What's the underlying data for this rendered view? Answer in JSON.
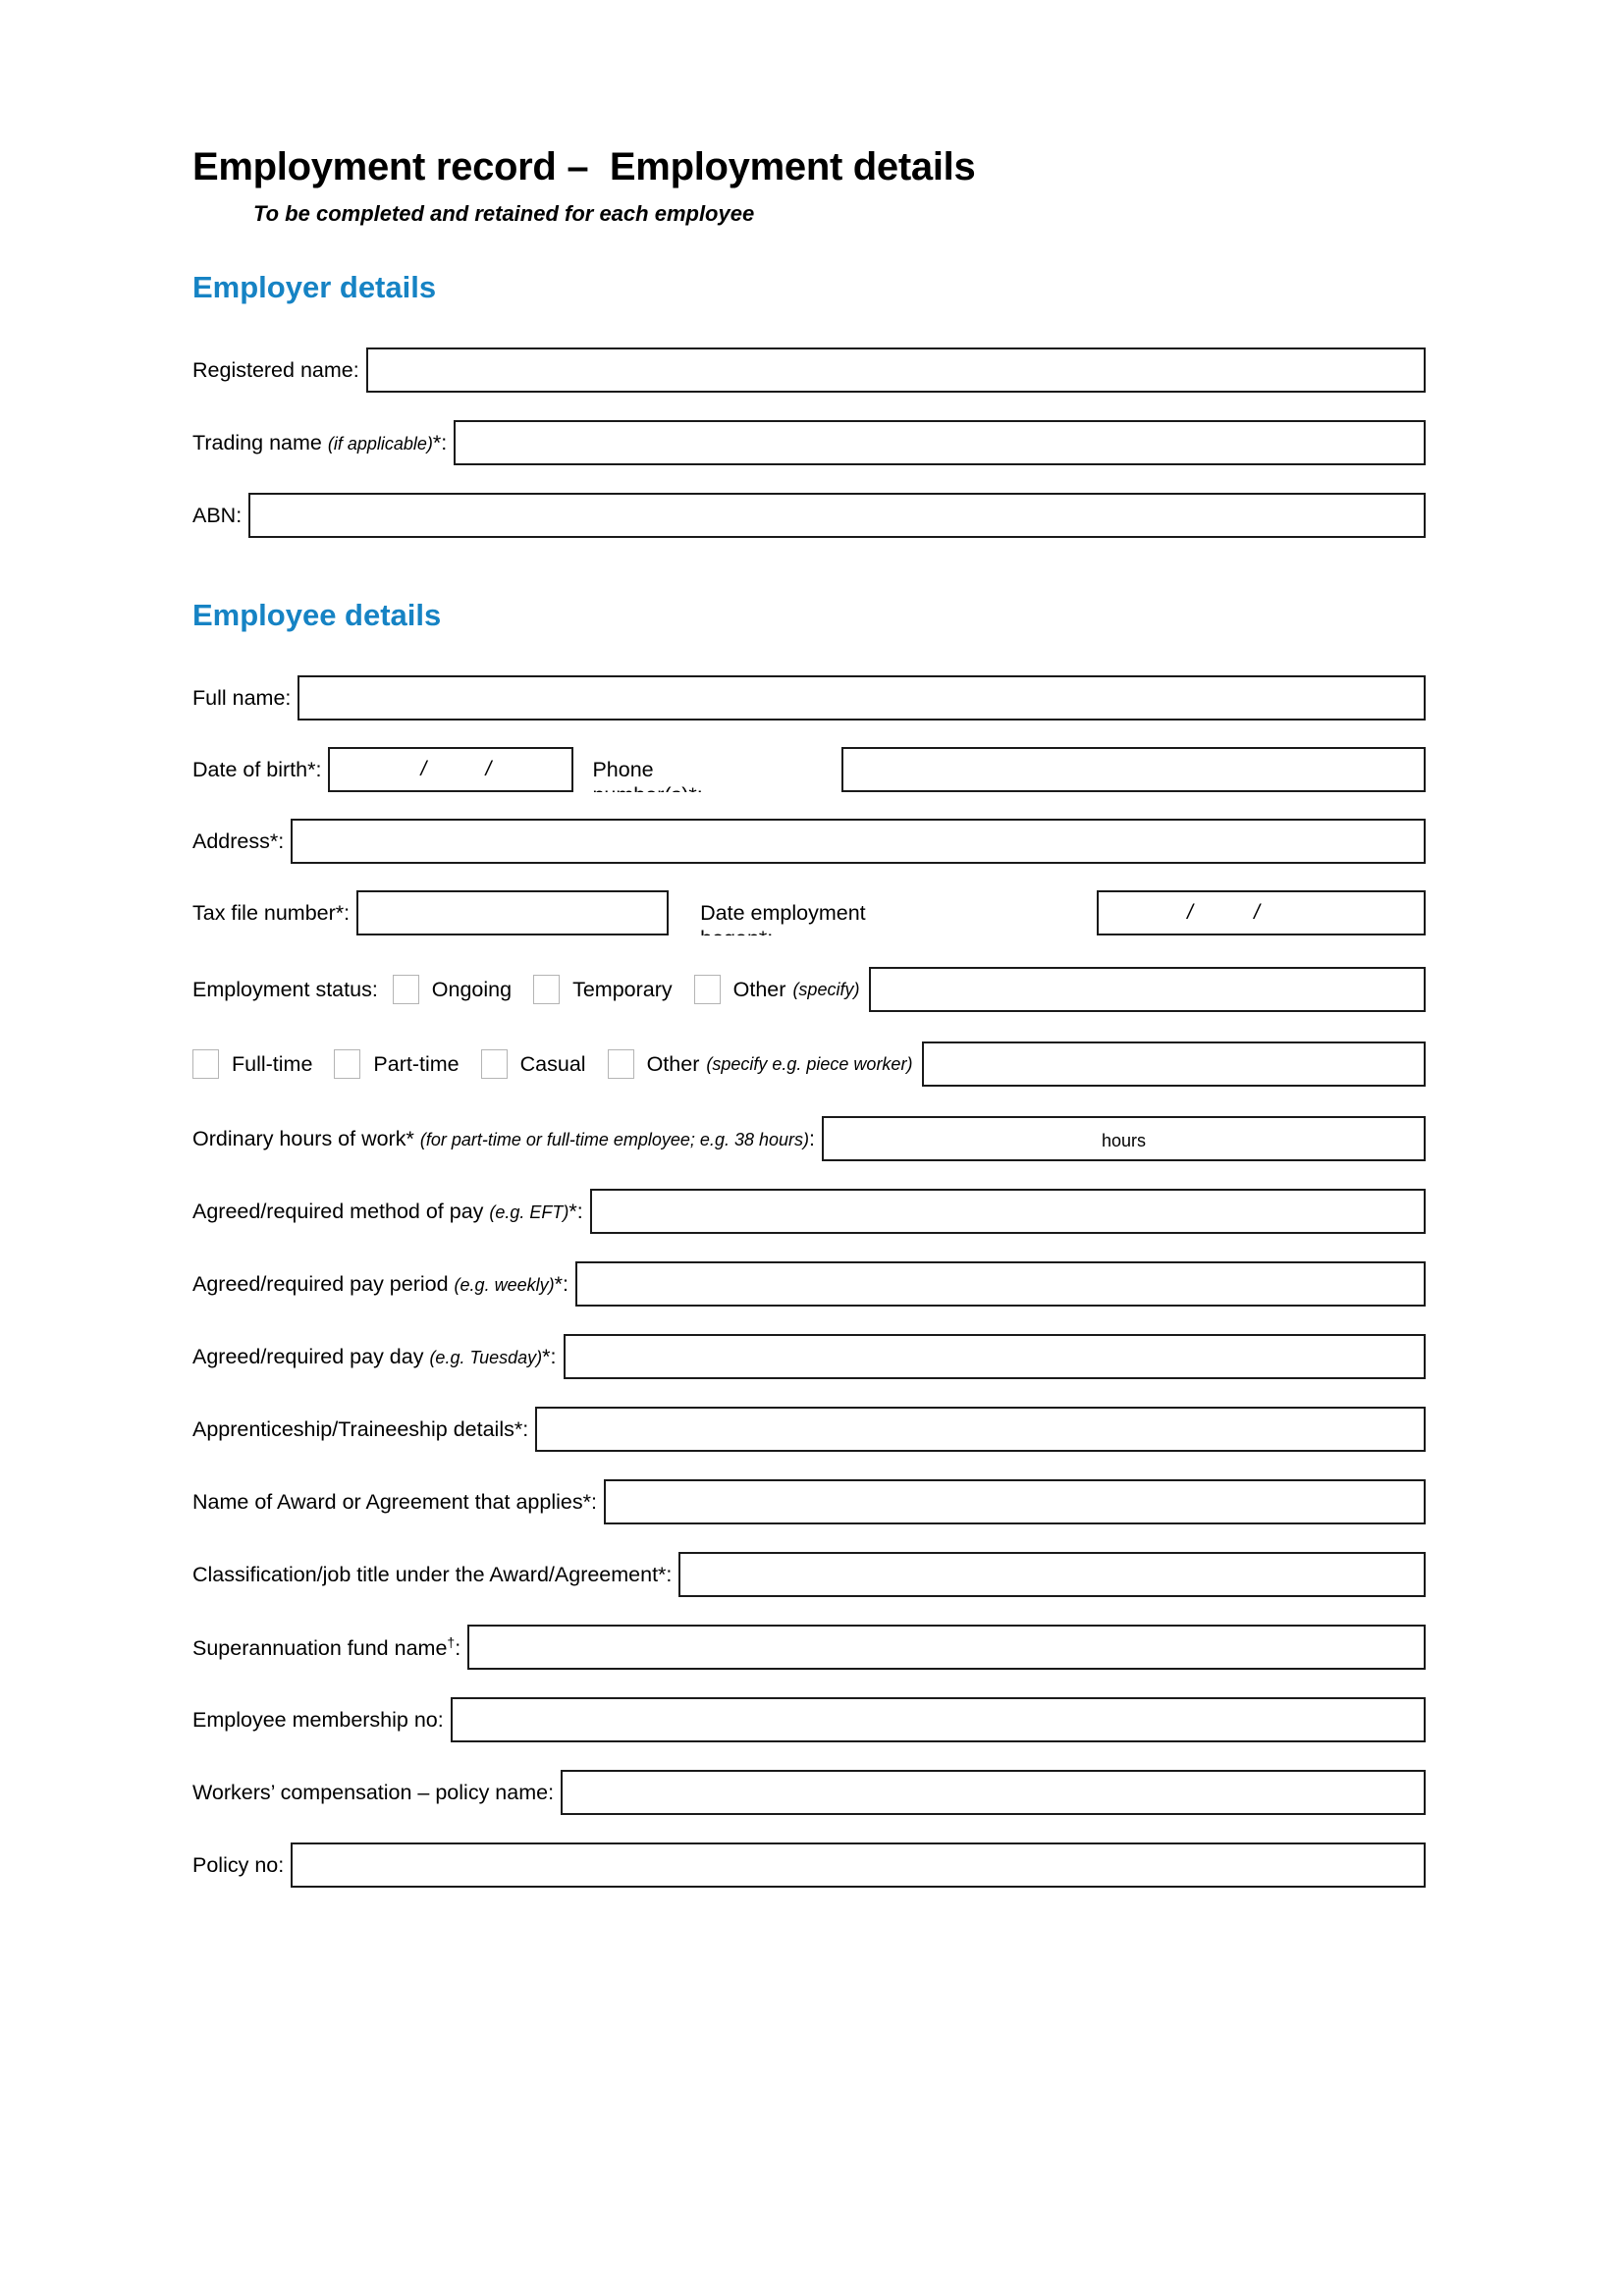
{
  "document": {
    "title": "Employment record –  Employment details",
    "subtitle": "To be completed and retained for each employee",
    "accent_color": "#1683c4",
    "box_border_color": "#1a1a1a",
    "checkbox_border_color": "#b4b4b4"
  },
  "employer_section": {
    "heading": "Employer details",
    "fields": [
      {
        "label": "Registered name:",
        "value": ""
      },
      {
        "label_main": "Trading name ",
        "label_italic": "(if applicable)",
        "label_tail": "*:",
        "value": ""
      },
      {
        "label": "ABN:",
        "value": ""
      }
    ]
  },
  "employee_section": {
    "heading": "Employee details",
    "full_name": {
      "label": "Full name:",
      "value": ""
    },
    "dob": {
      "label": "Date of birth*:",
      "value": "",
      "separator": "/"
    },
    "phone": {
      "label_line1": "Phone",
      "label_line2": "number(s)*:",
      "value": ""
    },
    "address": {
      "label": "Address*:",
      "value": ""
    },
    "tax_file_number": {
      "label": "Tax file number*:",
      "value": ""
    },
    "date_employment": {
      "label_line1": "Date employment",
      "label_line2": "began*:",
      "value": "",
      "separator": "/"
    },
    "employment_status": {
      "label": "Employment status:",
      "options": [
        {
          "label": "Ongoing",
          "checked": false
        },
        {
          "label": "Temporary",
          "checked": false
        },
        {
          "label": "Other",
          "hint": "(specify)",
          "checked": false
        }
      ],
      "other_value": ""
    },
    "employment_type": {
      "options": [
        {
          "label": "Full-time",
          "checked": false
        },
        {
          "label": "Part-time",
          "checked": false
        },
        {
          "label": "Casual",
          "checked": false
        },
        {
          "label": "Other",
          "hint": "(specify e.g. piece worker)",
          "checked": false
        }
      ],
      "other_value": ""
    },
    "ordinary_hours": {
      "label_main": "Ordinary hours of work*",
      "label_italic": "(for part-time or full-time employee; e.g. 38 hours)",
      "label_tail": ":",
      "unit_text": "hours",
      "value": ""
    },
    "fields": [
      {
        "label_main": "Agreed/required method of pay ",
        "label_italic": "(e.g. EFT)",
        "label_tail": "*:",
        "value": ""
      },
      {
        "label_main": "Agreed/required pay period ",
        "label_italic": "(e.g. weekly)",
        "label_tail": "*:",
        "value": ""
      },
      {
        "label_main": "Agreed/required pay day ",
        "label_italic": "(e.g. Tuesday)",
        "label_tail": "*:",
        "value": ""
      },
      {
        "label": "Apprenticeship/Traineeship details*:",
        "value": ""
      },
      {
        "label": "Name of Award or Agreement that applies*:",
        "value": ""
      },
      {
        "label": "Classification/job title under the Award/Agreement*:",
        "value": ""
      },
      {
        "label_main": "Superannuation fund name",
        "label_sup": "†",
        "label_tail": ":",
        "value": ""
      },
      {
        "label": "Employee membership no:",
        "value": ""
      },
      {
        "label": "Workers’ compensation – policy name:",
        "value": ""
      },
      {
        "label": "Policy no:",
        "value": ""
      }
    ]
  }
}
